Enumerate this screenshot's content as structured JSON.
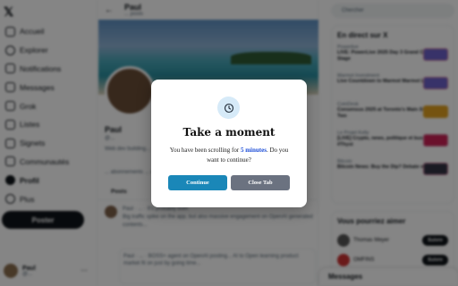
{
  "sidebar": {
    "nav": [
      "Accueil",
      "Explorer",
      "Notifications",
      "Messages",
      "Grok",
      "Listes",
      "Signets",
      "Communautés",
      "Profil",
      "Plus"
    ],
    "post_label": "Poster",
    "account_name": "Paul",
    "account_handle": "@..."
  },
  "profile": {
    "title": "Paul",
    "subtitle": "... posts",
    "name": "Paul",
    "handle": "@...",
    "bio": "Web dev building...",
    "stats": "... abonnements ... abonnés",
    "tab_posts": "Posts",
    "tweet1": "Paul · ... · It's probably both",
    "tweet1_more": "Big traffic spike on the app, but also massive engagement on OpenAI generated contents...",
    "tweet2": "Paul · ... · BOSS+ agent on OpenAI posting... AI to Open learning product market fit on just by going time..."
  },
  "right": {
    "search_placeholder": "Chercher",
    "trends_title": "En direct sur X",
    "trends": [
      {
        "source": "Powerlive",
        "title": "LIVE: PowerLive 2025 Day 3 Grand Central Stage"
      },
      {
        "source": "Marmot Investment",
        "title": "Live Countdown to Marmot Marmot Launch"
      },
      {
        "source": "CoinDesk",
        "title": "Consensus 2025 at Toronto's  Main Stage – Day Two"
      },
      {
        "source": "Le Projet Kelly",
        "title": "[LIVE] Crypto, news, politique et business #Thyst"
      },
      {
        "source": "Bitcoin",
        "title": "Bitcoin News: Buy the Dip? Debate with Marco"
      }
    ],
    "follow_title": "Vous pourriez aimer",
    "follow": [
      {
        "name": "Thomas Meyer",
        "btn": "Suivre"
      },
      {
        "name": "OMFINS",
        "btn": "Suivre"
      }
    ],
    "messages_label": "Messages"
  },
  "modal": {
    "icon": "clock-icon",
    "title": "Take a moment",
    "message_prefix": "You have been scrolling for ",
    "message_highlight": "5 minutes",
    "message_suffix": ". Do you want to continue?",
    "continue_label": "Continue",
    "close_label": "Close Tab",
    "colors": {
      "continue": "#1a87b8",
      "close": "#6b7280",
      "highlight": "#1d4ed8",
      "icon_bg": "#d6eaf8"
    }
  }
}
